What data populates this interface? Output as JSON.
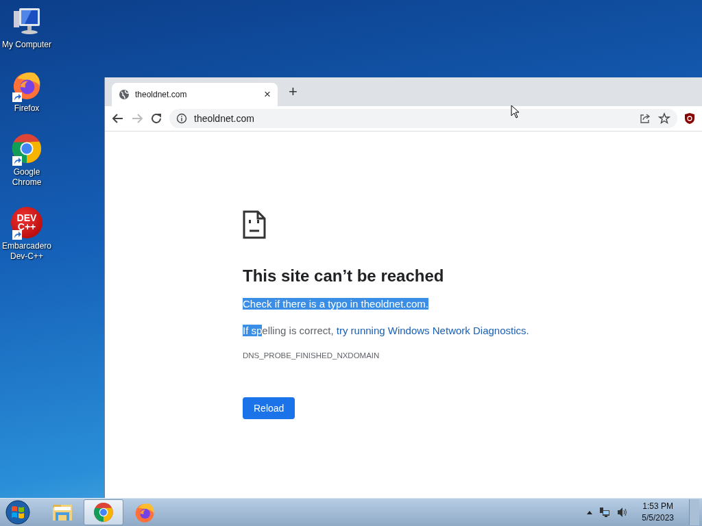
{
  "desktop_icons": [
    {
      "kind": "computer",
      "label": "My Computer",
      "shortcut": false
    },
    {
      "kind": "firefox",
      "label": "Firefox",
      "shortcut": true
    },
    {
      "kind": "chrome",
      "label": "Google Chrome",
      "shortcut": true
    },
    {
      "kind": "devcpp",
      "label": "Embarcadero Dev-C++",
      "shortcut": true,
      "logo": "DEV C++"
    }
  ],
  "browser": {
    "tabs": [
      {
        "title": "theoldnet.com",
        "selected": true,
        "close": "×"
      }
    ],
    "new_tab": "+",
    "address": "theoldnet.com",
    "forward_disabled": true,
    "page": {
      "title": "This site can’t be reached",
      "suggestions": [
        {
          "segments": [
            {
              "kind": "text",
              "text": "Check if there is a typo in theoldnet.com.",
              "selected": true
            }
          ]
        },
        {
          "segments": [
            {
              "kind": "text",
              "text": "If sp",
              "selected": true
            },
            {
              "kind": "text",
              "text": "elling is correct, ",
              "selected": false
            },
            {
              "kind": "link",
              "text": "try running Windows Network Diagnostics.",
              "selected": false
            }
          ]
        }
      ],
      "error_code": "DNS_PROBE_FINISHED_NXDOMAIN",
      "button": "Reload"
    }
  },
  "taskbar": {
    "items": [
      {
        "kind": "explorer",
        "selected": false
      },
      {
        "kind": "chrome",
        "selected": true
      },
      {
        "kind": "firefox",
        "selected": false
      }
    ],
    "time": "1:53 PM",
    "date": "5/5/2023"
  }
}
